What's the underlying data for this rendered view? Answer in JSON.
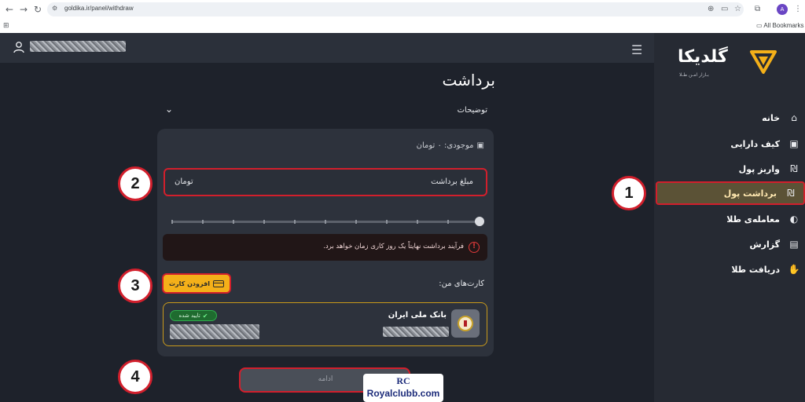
{
  "browser": {
    "url": "goldika.ir/panel/withdraw",
    "profile_initial": "A",
    "bookmarks_label": "All Bookmarks"
  },
  "sidebar": {
    "logo_text": "گلدیکا",
    "logo_subtitle": "بـازار امـن طـلا",
    "items": [
      {
        "label": "خانه",
        "icon": "home-icon",
        "active": false
      },
      {
        "label": "کیف دارایی",
        "icon": "wallet-icon",
        "active": false
      },
      {
        "label": "واریز پول",
        "icon": "money-bag-icon",
        "active": false
      },
      {
        "label": "برداشت پول",
        "icon": "money-bag-icon",
        "active": true
      },
      {
        "label": "معامله‌ی طلا",
        "icon": "exchange-icon",
        "active": false
      },
      {
        "label": "گزارش",
        "icon": "report-icon",
        "active": false
      },
      {
        "label": "دریافت طلا",
        "icon": "receive-hand-icon",
        "active": false
      }
    ]
  },
  "main": {
    "title": "برداشت",
    "description_label": "توضیحات",
    "balance_text": "موجودی: ۰ تومان",
    "amount": {
      "label": "مبلغ برداشت",
      "unit": "تومان"
    },
    "alert_text": "فرآیند برداشت نهایتاً یک روز کاری زمان خواهد برد.",
    "my_cards_title": "کارت‌های من:",
    "add_card_label": "افزودن کارت",
    "bank_card": {
      "bank_name": "بانک ملی ایران",
      "status_label": "تایید شده"
    },
    "continue_label": "ادامه"
  },
  "steps": [
    "1",
    "2",
    "3",
    "4"
  ],
  "watermark": {
    "mark": "RC",
    "text": "Royalclubb.com"
  },
  "colors": {
    "accent_red": "#d21f2c",
    "gold": "#f4b019",
    "sidebar_active": "#5b5236"
  }
}
